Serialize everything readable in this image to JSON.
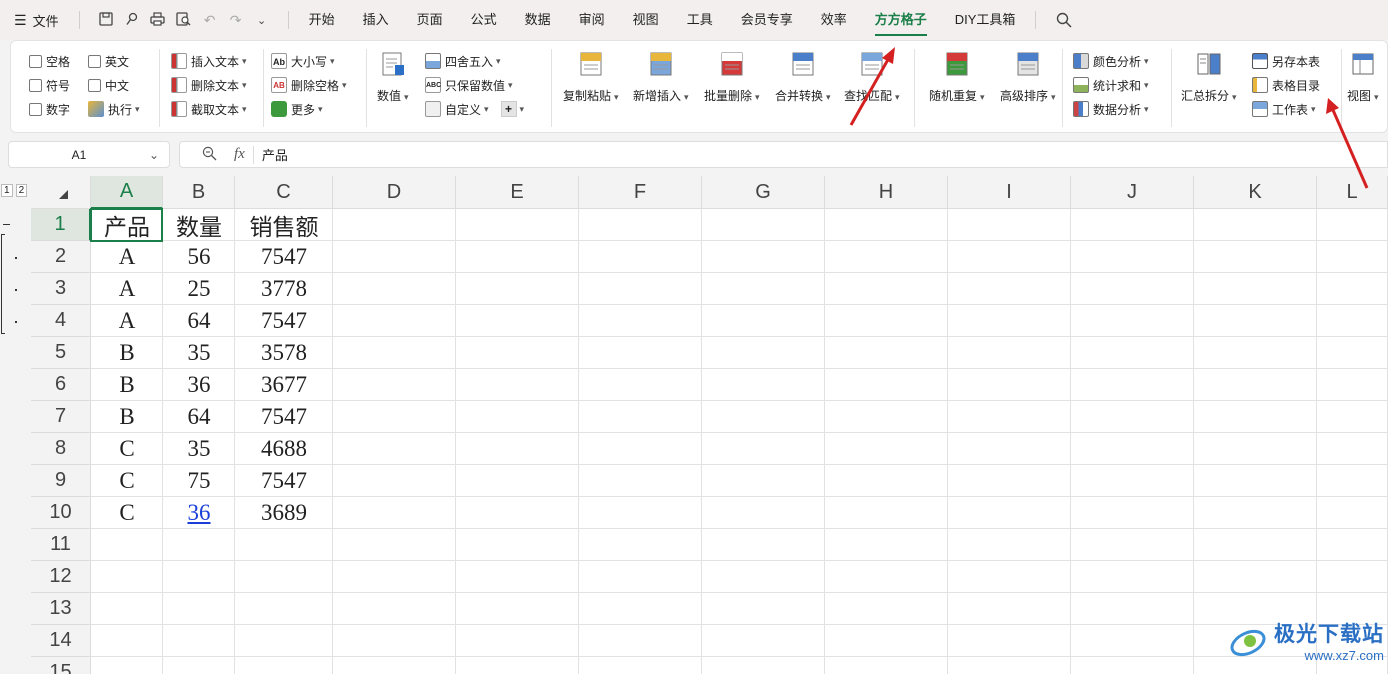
{
  "menu": {
    "file_label": "文件",
    "tabs": [
      "开始",
      "插入",
      "页面",
      "公式",
      "数据",
      "审阅",
      "视图",
      "工具",
      "会员专享",
      "效率",
      "方方格子",
      "DIY工具箱"
    ],
    "active_tab": "方方格子"
  },
  "ribbon": {
    "checkboxes": {
      "col1": [
        "空格",
        "符号",
        "数字"
      ],
      "col2": [
        "英文",
        "中文"
      ],
      "execute": "执行"
    },
    "text_group": [
      "插入文本",
      "删除文本",
      "截取文本"
    ],
    "case_group": [
      "大小写",
      "删除空格",
      "更多"
    ],
    "value_btn": "数值",
    "round_group": [
      "四舍五入",
      "只保留数值",
      "自定义"
    ],
    "big_buttons": [
      "复制粘贴",
      "新增插入",
      "批量删除",
      "合并转换",
      "查找匹配",
      "随机重复",
      "高级排序"
    ],
    "analysis_group": [
      "颜色分析",
      "统计求和",
      "数据分析"
    ],
    "summary_btn": "汇总拆分",
    "save_group": [
      "另存本表",
      "表格目录",
      "工作表"
    ],
    "view_btn": "视图",
    "colors": {
      "accent": "#1a7f48",
      "arrow": "#d42020"
    }
  },
  "formula_bar": {
    "name_box": "A1",
    "fx_label": "fx",
    "content": "产品"
  },
  "outline_levels": [
    "1",
    "2"
  ],
  "columns": [
    "A",
    "B",
    "C",
    "D",
    "E",
    "F",
    "G",
    "H",
    "I",
    "J",
    "K",
    "L"
  ],
  "rows": [
    "1",
    "2",
    "3",
    "4",
    "5",
    "6",
    "7",
    "8",
    "9",
    "10",
    "11",
    "12",
    "13",
    "14",
    "15"
  ],
  "table": {
    "header": [
      "产品",
      "数量",
      "销售额"
    ],
    "data": [
      [
        "A",
        "56",
        "7547"
      ],
      [
        "A",
        "25",
        "3778"
      ],
      [
        "A",
        "64",
        "7547"
      ],
      [
        "B",
        "35",
        "3578"
      ],
      [
        "B",
        "36",
        "3677"
      ],
      [
        "B",
        "64",
        "7547"
      ],
      [
        "C",
        "35",
        "4688"
      ],
      [
        "C",
        "75",
        "7547"
      ],
      [
        "C",
        "36",
        "3689"
      ]
    ]
  },
  "watermark": {
    "title": "极光下载站",
    "url": "www.xz7.com"
  }
}
